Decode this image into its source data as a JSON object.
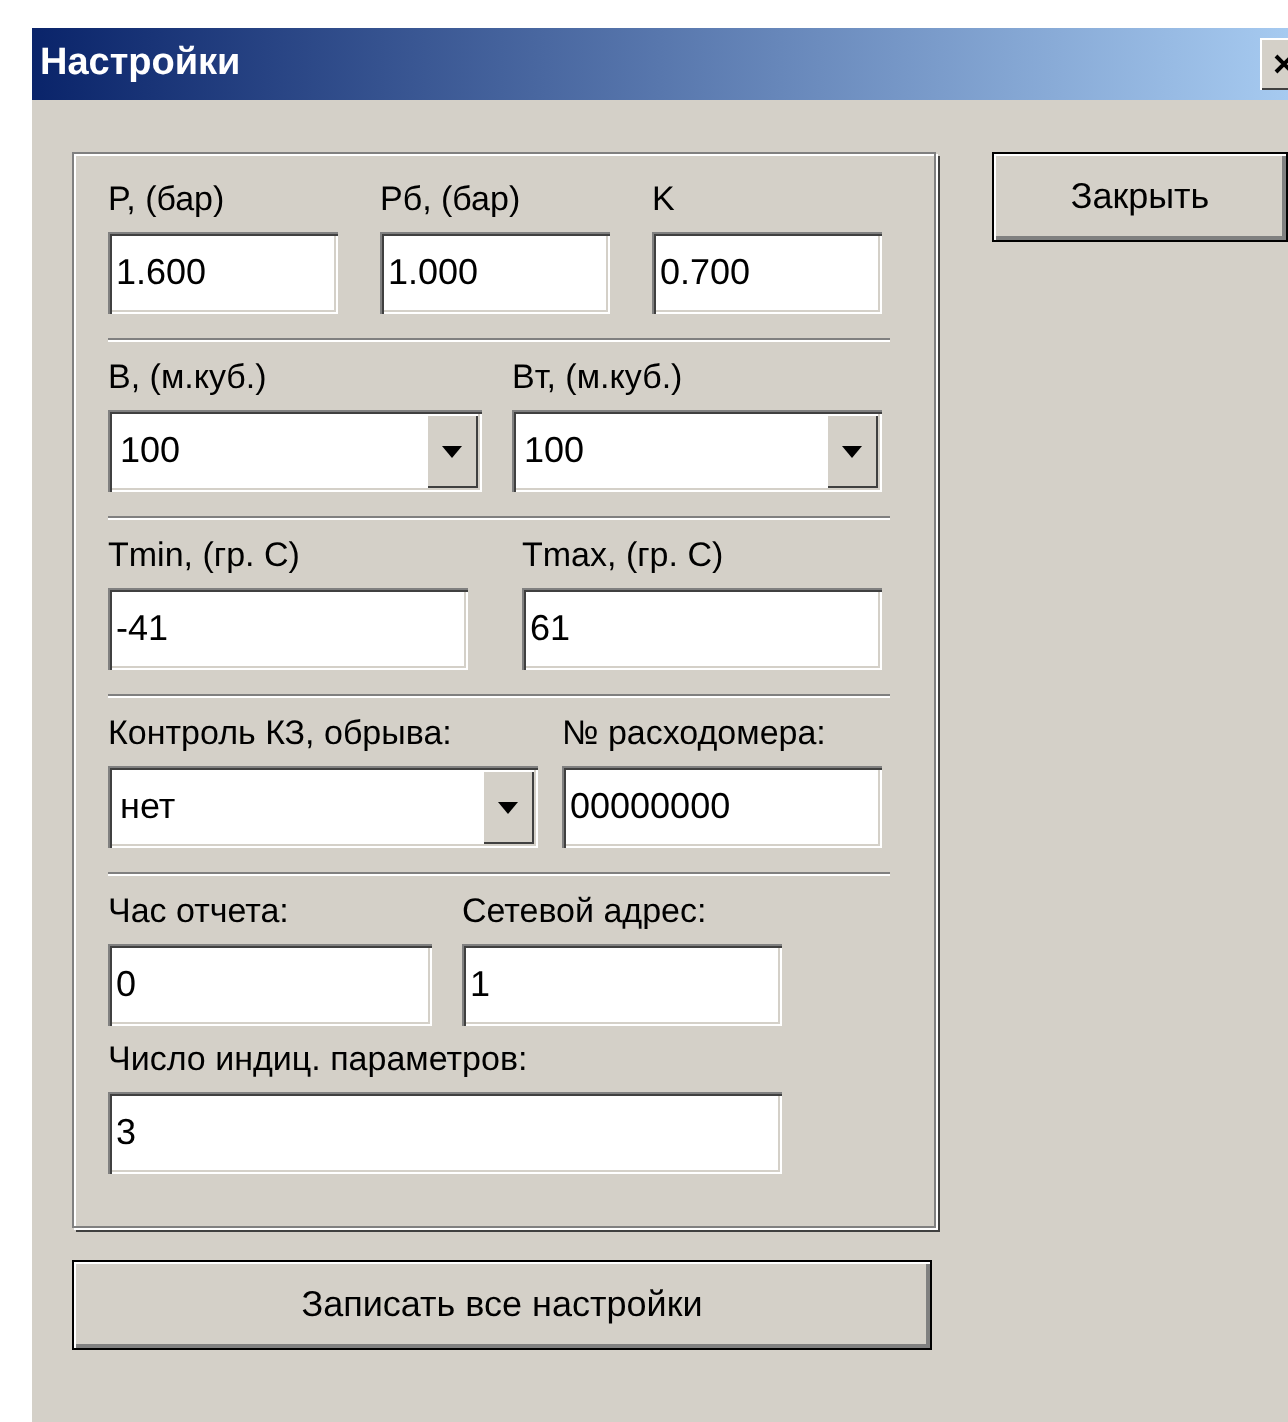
{
  "window": {
    "title": "Настройки"
  },
  "settings_group": {
    "sections": [
      {
        "rows": [
          [
            {
              "kind": "text",
              "label": "P, (бар)",
              "value": "1.600"
            },
            {
              "kind": "text",
              "label": "Pб, (бар)",
              "value": "1.000"
            },
            {
              "kind": "text",
              "label": "K",
              "value": "0.700"
            }
          ]
        ]
      },
      {
        "rows": [
          [
            {
              "kind": "combo",
              "label": "B, (м.куб.)",
              "value": "100"
            },
            {
              "kind": "combo",
              "label": "Bт, (м.куб.)",
              "value": "100"
            }
          ]
        ]
      },
      {
        "rows": [
          [
            {
              "kind": "text",
              "label": "Tmin, (гр. C)",
              "value": "-41"
            },
            {
              "kind": "text",
              "label": "Tmax, (гр. C)",
              "value": "61"
            }
          ]
        ]
      },
      {
        "rows": [
          [
            {
              "kind": "combo",
              "label": "Контроль КЗ, обрыва:",
              "value": "нет"
            },
            {
              "kind": "text",
              "label": "№ расходомера:",
              "value": "00000000"
            }
          ]
        ]
      },
      {
        "rows": [
          [
            {
              "kind": "text",
              "label": "Час отчета:",
              "value": "0"
            },
            {
              "kind": "text",
              "label": "Сетевой адрес:",
              "value": "1"
            }
          ],
          [
            {
              "kind": "text",
              "label": "Число индиц. параметров:",
              "value": "3"
            }
          ]
        ]
      }
    ]
  },
  "buttons": {
    "close": "Закрыть",
    "save_all": "Записать все настройки"
  }
}
